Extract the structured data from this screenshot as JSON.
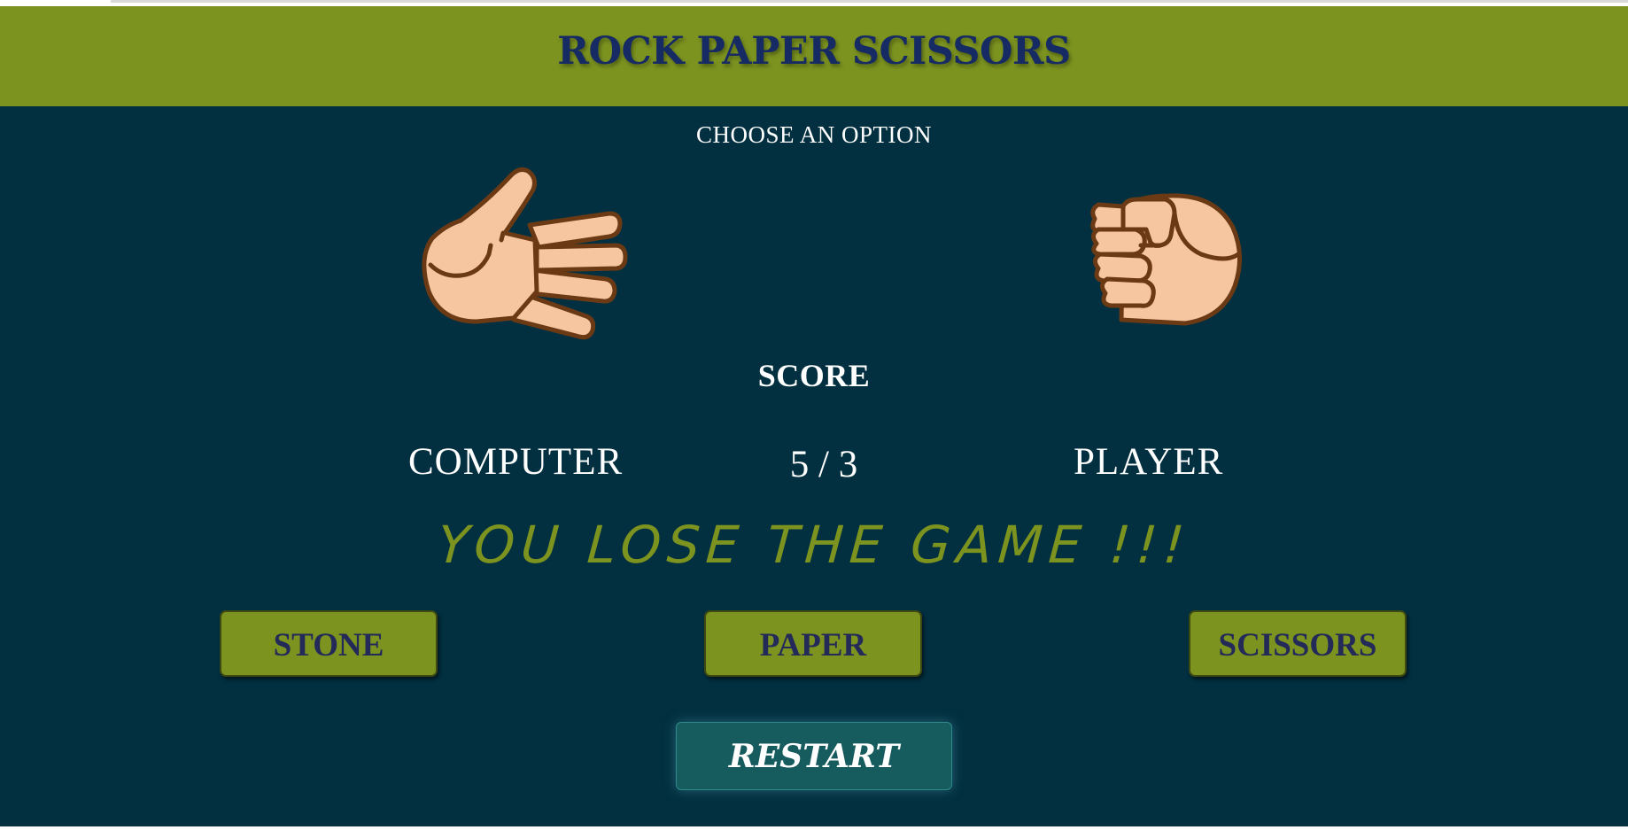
{
  "header": {
    "title": "ROCK PAPER SCISSORS"
  },
  "prompt": "CHOOSE AN OPTION",
  "hands": {
    "computer": "open-hand-paper-icon",
    "player": "fist-rock-icon"
  },
  "score": {
    "label": "SCORE",
    "computer_label": "COMPUTER",
    "player_label": "PLAYER",
    "value": "5 / 3"
  },
  "result": "YOU LOSE THE GAME !!!",
  "buttons": {
    "stone": "STONE",
    "paper": "PAPER",
    "scissors": "SCISSORS",
    "restart": "RESTART"
  },
  "colors": {
    "background": "#023040",
    "header": "#7c9320",
    "title": "#162a63",
    "result": "#7c9320",
    "button": "#7c9320",
    "restart": "#165b5e",
    "skin": "#f5c6a0",
    "outline": "#6b3a14"
  }
}
